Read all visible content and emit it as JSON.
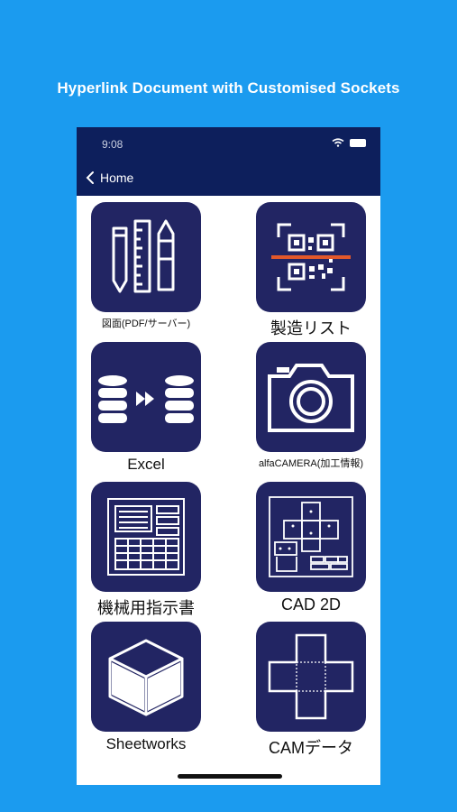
{
  "headline": "Hyperlink Document with Customised Sockets",
  "status": {
    "time": "9:08"
  },
  "nav": {
    "back_label": "Home"
  },
  "tiles": [
    {
      "label": "図面(PDF/サーバー)",
      "icon": "drawing-tools-icon"
    },
    {
      "label": "製造リスト",
      "icon": "qr-scan-icon"
    },
    {
      "label": "Excel",
      "icon": "database-transfer-icon"
    },
    {
      "label": "alfaCAMERA(加工情報)",
      "icon": "camera-icon"
    },
    {
      "label": "機械用指示書",
      "icon": "instruction-sheet-icon"
    },
    {
      "label": "CAD 2D",
      "icon": "cad-drawing-icon"
    },
    {
      "label": "Sheetworks",
      "icon": "cube-icon"
    },
    {
      "label": "CAMデータ",
      "icon": "unfolded-box-icon"
    }
  ],
  "colors": {
    "background": "#1b9bef",
    "navbar": "#0d1f5c",
    "tile": "#222563",
    "scan_line": "#e2582a"
  }
}
